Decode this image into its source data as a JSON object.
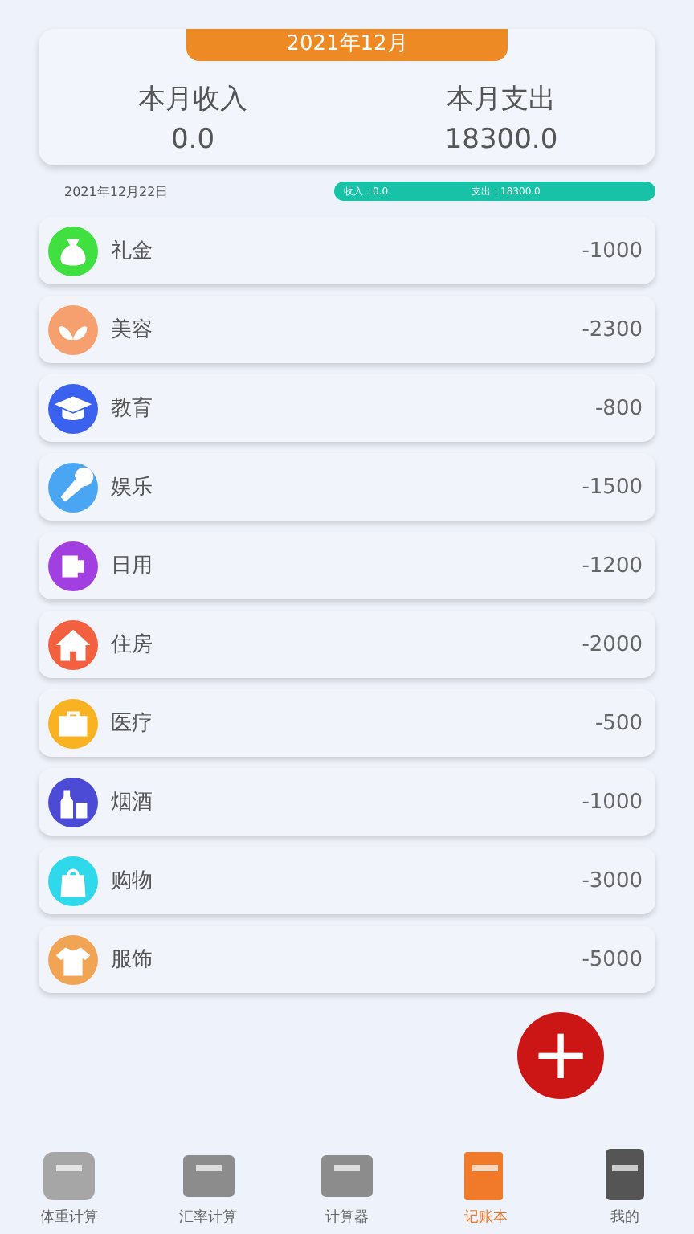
{
  "summary": {
    "month": "2021年12月",
    "income_label": "本月收入",
    "income": "0.0",
    "expense_label": "本月支出",
    "expense": "18300.0"
  },
  "day": {
    "date": "2021年12月22日",
    "income": "收入：0.0",
    "expense": "支出：18300.0"
  },
  "entries": [
    {
      "name": "礼金",
      "amount": "-1000",
      "color": "#3fe03f"
    },
    {
      "name": "美容",
      "amount": "-2300",
      "color": "#f5a06e"
    },
    {
      "name": "教育",
      "amount": "-800",
      "color": "#3a62ef"
    },
    {
      "name": "娱乐",
      "amount": "-1500",
      "color": "#4aa6f2"
    },
    {
      "name": "日用",
      "amount": "-1200",
      "color": "#a23fe0"
    },
    {
      "name": "住房",
      "amount": "-2000",
      "color": "#f2603f"
    },
    {
      "name": "医疗",
      "amount": "-500",
      "color": "#f8b222"
    },
    {
      "name": "烟酒",
      "amount": "-1000",
      "color": "#4b4bd6"
    },
    {
      "name": "购物",
      "amount": "-3000",
      "color": "#2fd8ea"
    },
    {
      "name": "服饰",
      "amount": "-5000",
      "color": "#f2a455"
    }
  ],
  "add_button": "+",
  "nav": [
    {
      "label": "体重计算",
      "selected": false
    },
    {
      "label": "汇率计算",
      "selected": false
    },
    {
      "label": "计算器",
      "selected": false
    },
    {
      "label": "记账本",
      "selected": true
    },
    {
      "label": "我的",
      "selected": false
    }
  ]
}
